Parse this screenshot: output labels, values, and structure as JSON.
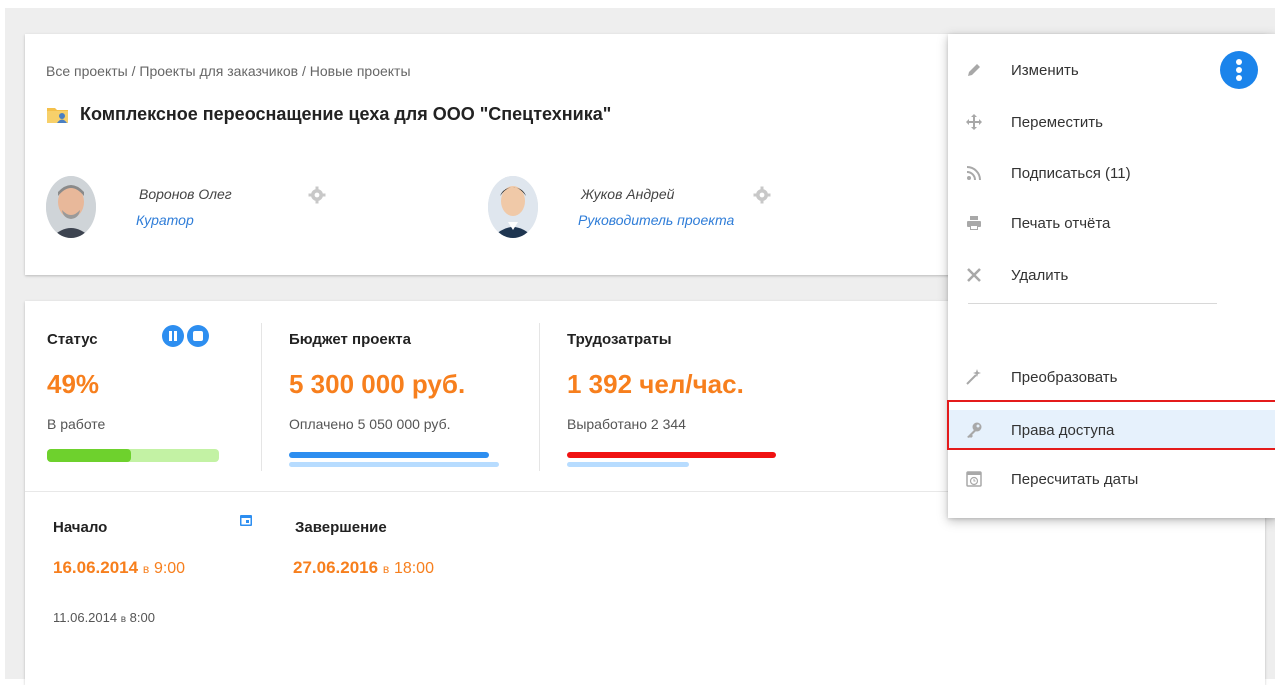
{
  "header": {
    "breadcrumb": "Все проекты / Проекты для заказчиков / Новые проекты",
    "title": "Комплексное переоснащение цеха для ООО \"Спецтехника\"",
    "people": [
      {
        "name": "Воронов Олег",
        "role": "Куратор"
      },
      {
        "name": "Жуков Андрей",
        "role": "Руководитель проекта"
      }
    ]
  },
  "stats": {
    "status": {
      "label": "Статус",
      "value": "49%",
      "sub": "В работе",
      "progress": 0.49
    },
    "budget": {
      "label": "Бюджет проекта",
      "value": "5 300 000 руб.",
      "sub": "Оплачено 5 050 000 руб."
    },
    "labor": {
      "label": "Трудозатраты",
      "value": "1 392 чел/час.",
      "sub": "Выработано 2 344"
    }
  },
  "dates": {
    "start": {
      "label": "Начало",
      "date": "16.06.2014",
      "at": "в",
      "time": "9:00"
    },
    "end": {
      "label": "Завершение",
      "date": "27.06.2016",
      "at": "в",
      "time": "18:00"
    },
    "extra": {
      "date": "11.06.2014",
      "at": "в",
      "time": "8:00"
    }
  },
  "menu": {
    "items": [
      {
        "label": "Изменить",
        "icon": "pencil-icon"
      },
      {
        "label": "Переместить",
        "icon": "move-icon"
      },
      {
        "label": "Подписаться (11)",
        "icon": "rss-icon"
      },
      {
        "label": "Печать отчёта",
        "icon": "printer-icon"
      },
      {
        "label": "Удалить",
        "icon": "close-icon"
      },
      {
        "label": "Преобразовать",
        "icon": "magic-wand-icon"
      },
      {
        "label": "Права доступа",
        "icon": "key-icon"
      },
      {
        "label": "Пересчитать даты",
        "icon": "calendar-clock-icon"
      }
    ],
    "active_item": "Права доступа"
  },
  "colors": {
    "accent": "#2d8ef0",
    "orange": "#f77f1d",
    "link": "#2f7dd8",
    "highlight_border": "#e41b1b",
    "progress_green": "#6ed12d",
    "progress_green_light": "#c3f2a4",
    "labor_red": "#f01212"
  }
}
